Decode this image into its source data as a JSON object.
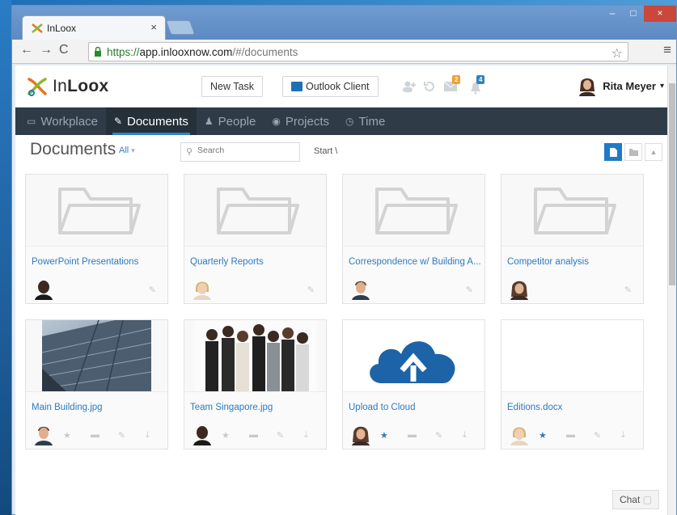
{
  "browser": {
    "tab_title": "InLoox",
    "tab_close": "×",
    "url_scheme": "https://",
    "url_host": "app.inlooxnow.com",
    "url_path": "/#/documents",
    "window_buttons": [
      "–",
      "□",
      "×"
    ]
  },
  "header": {
    "logo_prefix": "In",
    "logo_bold": "Loox",
    "new_task_label": "New Task",
    "outlook_label": "Outlook Client",
    "badge_mail": "2",
    "badge_bell": "4",
    "user_name": "Rita Meyer",
    "user_caret": "▾"
  },
  "nav": {
    "items": [
      {
        "label": "Workplace",
        "icon": "monitor-icon",
        "active": false
      },
      {
        "label": "Documents",
        "icon": "paperclip-icon",
        "active": true
      },
      {
        "label": "People",
        "icon": "person-icon",
        "active": false
      },
      {
        "label": "Projects",
        "icon": "target-icon",
        "active": false
      },
      {
        "label": "Time",
        "icon": "clock-icon",
        "active": false
      }
    ]
  },
  "toolbar": {
    "title": "Documents",
    "filter_label": "All",
    "search_placeholder": "Search",
    "breadcrumb": "Start  \\"
  },
  "cards": [
    {
      "title": "PowerPoint Presentations",
      "thumb": "folder",
      "avatar_color": "#3b2a22"
    },
    {
      "title": "Quarterly Reports",
      "thumb": "folder",
      "avatar_color": "#d9b46e"
    },
    {
      "title": "Correspondence w/ Building A...",
      "thumb": "folder",
      "avatar_color": "#6b4a3a"
    },
    {
      "title": "Competitor analysis",
      "thumb": "folder",
      "avatar_color": "#5a3b2c"
    },
    {
      "title": "Main Building.jpg",
      "thumb": "building",
      "avatar_color": "#6b4a3a",
      "starred": false
    },
    {
      "title": "Team Singapore.jpg",
      "thumb": "team",
      "avatar_color": "#3b2a22",
      "starred": false
    },
    {
      "title": "Upload to Cloud",
      "thumb": "cloud",
      "avatar_color": "#5a3b2c",
      "starred": true
    },
    {
      "title": "Editions.docx",
      "thumb": "blank",
      "avatar_color": "#d9b46e",
      "starred": true
    }
  ],
  "chat_label": "Chat",
  "colors": {
    "accent": "#2d82c8",
    "navbar": "#2f3c48",
    "cloud": "#1d63a8"
  }
}
